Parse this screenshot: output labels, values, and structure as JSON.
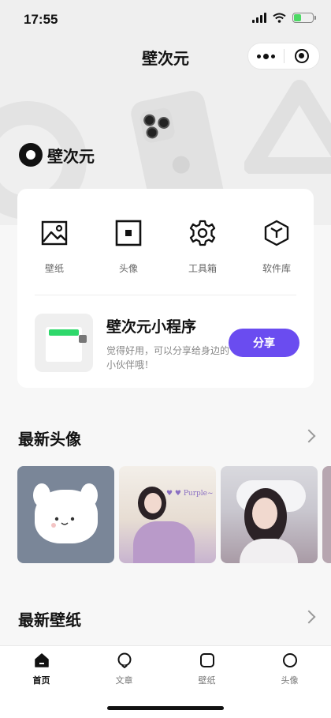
{
  "status_bar": {
    "time": "17:55"
  },
  "nav": {
    "title": "壁次元"
  },
  "brand": {
    "name": "壁次元"
  },
  "quick_actions": [
    {
      "label": "壁纸",
      "icon": "image-icon"
    },
    {
      "label": "头像",
      "icon": "avatar-frame-icon"
    },
    {
      "label": "工具箱",
      "icon": "gear-icon"
    },
    {
      "label": "软件库",
      "icon": "cube-icon"
    }
  ],
  "mini_program": {
    "title": "壁次元小程序",
    "description": "觉得好用，可以分享给身边的小伙伴哦！",
    "share_label": "分享"
  },
  "sections": {
    "avatars": {
      "title": "最新头像"
    },
    "wallpapers": {
      "title": "最新壁纸"
    }
  },
  "tabbar": [
    {
      "label": "首页",
      "active": true
    },
    {
      "label": "文章",
      "active": false
    },
    {
      "label": "壁纸",
      "active": false
    },
    {
      "label": "头像",
      "active": false
    }
  ],
  "colors": {
    "accent": "#6a4cf0",
    "battery": "#4cd964"
  }
}
